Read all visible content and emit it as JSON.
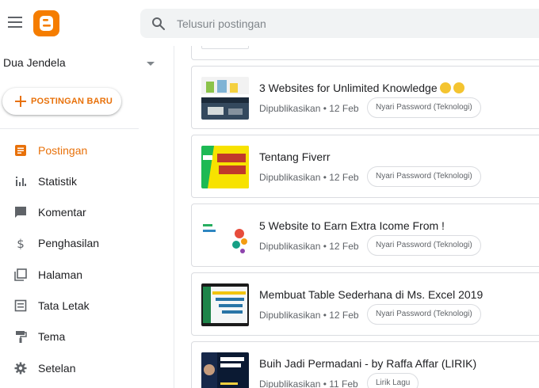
{
  "header": {
    "search_placeholder": "Telusuri postingan"
  },
  "sidebar": {
    "blog_name": "Dua Jendela",
    "new_post_label": "POSTINGAN BARU",
    "nav": [
      {
        "label": "Postingan",
        "icon": "posts-icon",
        "active": true
      },
      {
        "label": "Statistik",
        "icon": "stats-icon"
      },
      {
        "label": "Komentar",
        "icon": "comment-icon"
      },
      {
        "label": "Penghasilan",
        "icon": "dollar-icon"
      },
      {
        "label": "Halaman",
        "icon": "pages-icon"
      },
      {
        "label": "Tata Letak",
        "icon": "layout-icon"
      },
      {
        "label": "Tema",
        "icon": "paint-roller-icon"
      },
      {
        "label": "Setelan",
        "icon": "gear-icon"
      }
    ]
  },
  "posts": [
    {
      "title": "3 Websites for Unlimited Knowledge",
      "emojis": [
        "surprised-face-emoji",
        "screaming-face-emoji"
      ],
      "status": "Dipublikasikan • 12 Feb",
      "label": "Nyari Password (Teknologi)"
    },
    {
      "title": "Tentang Fiverr",
      "status": "Dipublikasikan • 12 Feb",
      "label": "Nyari Password (Teknologi)"
    },
    {
      "title": "5 Website to Earn Extra Icome From !",
      "status": "Dipublikasikan • 12 Feb",
      "label": "Nyari Password (Teknologi)"
    },
    {
      "title": "Membuat Table Sederhana di Ms. Excel 2019",
      "status": "Dipublikasikan • 12 Feb",
      "label": "Nyari Password (Teknologi)"
    },
    {
      "title": "Buih Jadi Permadani - by Raffa Affar (LIRIK)",
      "status": "Dipublikasikan • 11 Feb",
      "label": "Lirik Lagu"
    }
  ],
  "colors": {
    "accent": "#e8710a",
    "logo": "#f57d00"
  }
}
